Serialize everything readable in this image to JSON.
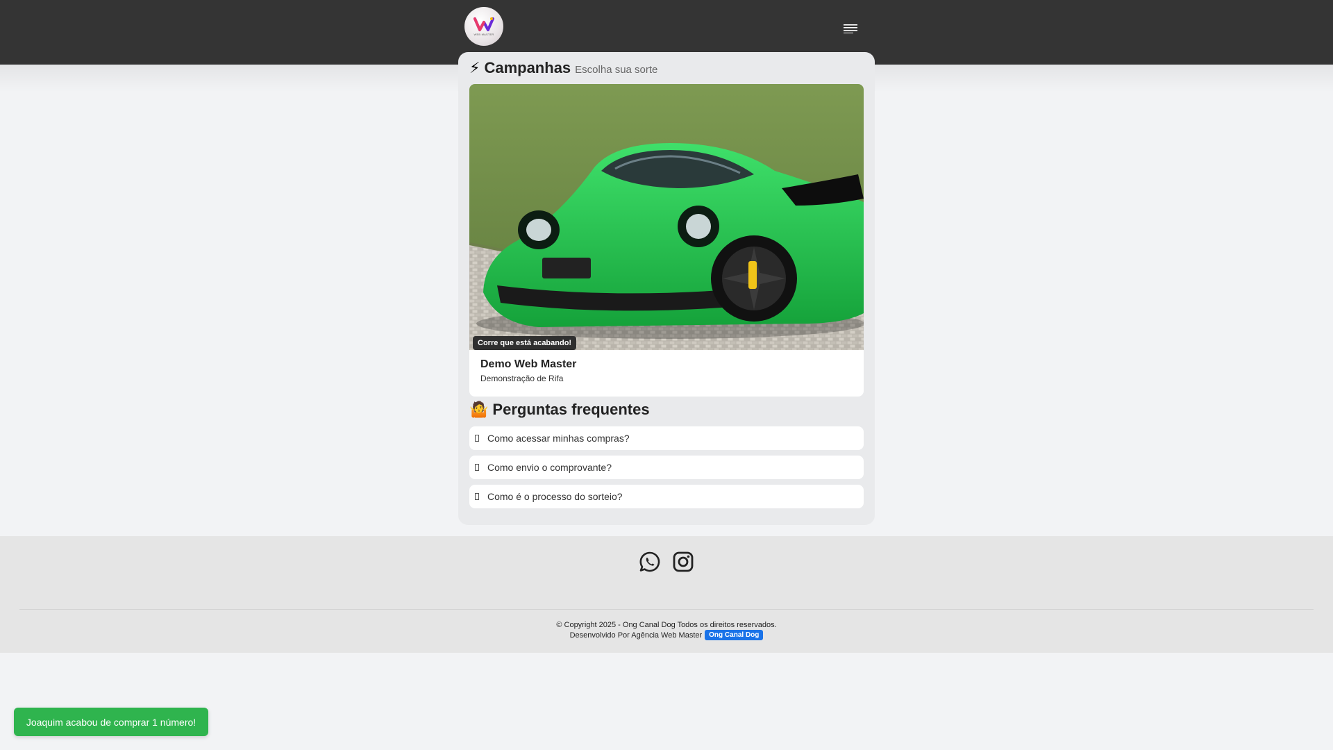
{
  "header": {
    "logo_text": "WEB MASTER",
    "menu_icon": "list-icon",
    "background": "#343434"
  },
  "campaigns": {
    "emoji": "⚡",
    "title": "Campanhas",
    "subtitle": "Escolha sua sorte",
    "items": [
      {
        "badge": "Corre que está acabando!",
        "name": "Demo Web Master",
        "description": "Demonstração de Rifa",
        "image_subject": "green-sports-car"
      }
    ]
  },
  "faq": {
    "emoji": "🤷",
    "title": "Perguntas frequentes",
    "items": [
      {
        "question": "Como acessar minhas compras?"
      },
      {
        "question": "Como envio o comprovante?"
      },
      {
        "question": "Como é o processo do sorteio?"
      }
    ]
  },
  "footer": {
    "social": [
      "whatsapp-icon",
      "instagram-icon"
    ],
    "copyright": "© Copyright 2025 - Ong Canal Dog Todos os direitos reservados.",
    "developed_by": "Desenvolvido Por Agência Web Master",
    "developed_badge": "Ong Canal Dog"
  },
  "toast": {
    "message": "Joaquim acabou de comprar 1 número!",
    "color": "#2fb44e"
  },
  "colors": {
    "page_bg": "#f2f3f5",
    "card_bg": "#e9eaec",
    "badge_blue": "#1a73e8"
  }
}
